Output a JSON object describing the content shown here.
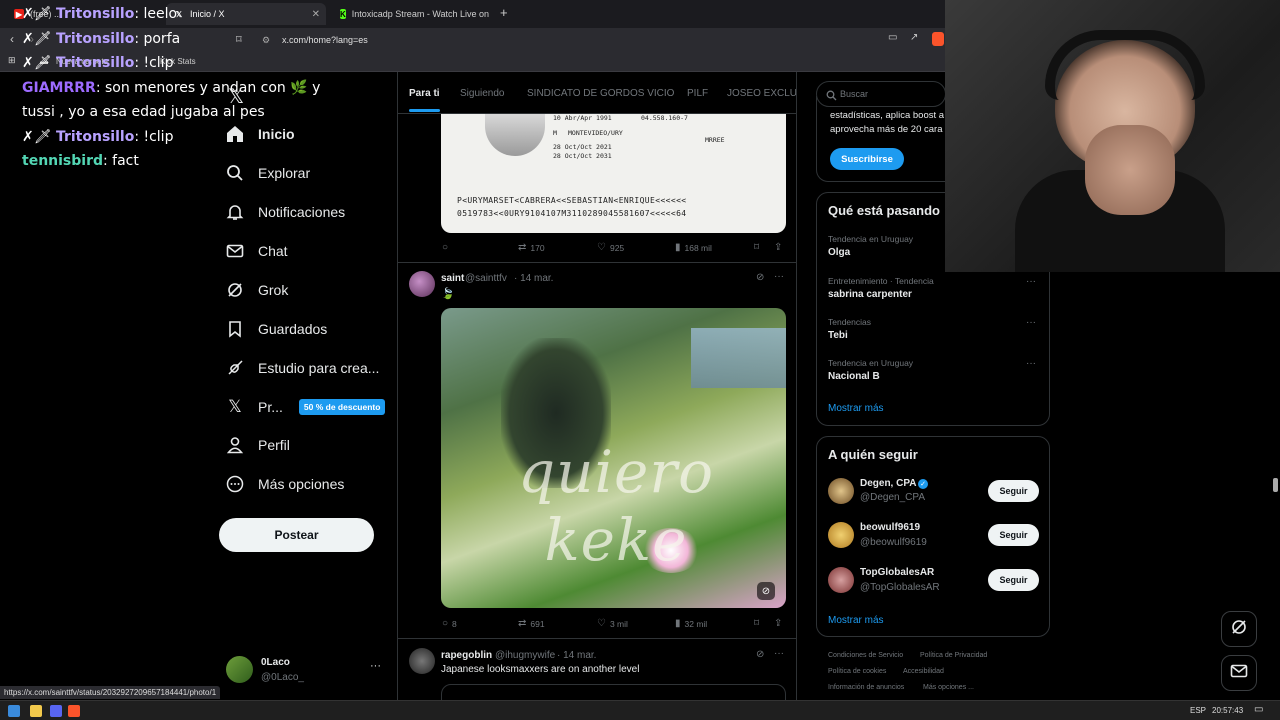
{
  "browser": {
    "tabs": [
      {
        "label": "(free) ...",
        "favicon": "youtube-icon"
      },
      {
        "label": "Inicio / X",
        "favicon": "x-logo-icon"
      },
      {
        "label": "Intoxicadp Stream - Watch Live on Ki",
        "favicon": "kick-icon"
      }
    ],
    "url": "x.com/home?lang=es",
    "bookmarks": [
      "Nueva carpeta",
      "Kick Stats"
    ],
    "status_url": "https://x.com/sainttfv/status/2032927209657184441/photo/1"
  },
  "chat": [
    {
      "user": "Tritonsillo",
      "message": "leelo",
      "badge": "sword-icon",
      "color": "#b8a2ff"
    },
    {
      "user": "Tritonsillo",
      "message": "porfa",
      "badge": "sword-icon",
      "color": "#b8a2ff"
    },
    {
      "user": "Tritonsillo",
      "message": "!clip",
      "badge": "sword-icon",
      "color": "#b8a2ff"
    },
    {
      "user": "GIAMRRR",
      "message": "son menores y andan con 🌿 y tussi , yo a esa edad jugaba al pes",
      "color": "#9d6bff"
    },
    {
      "user": "Tritonsillo",
      "message": "!clip",
      "badge": "sword-icon",
      "color": "#b8a2ff"
    },
    {
      "user": "tennisbird",
      "message": "fact",
      "color": "#53d6b4"
    }
  ],
  "nav": {
    "items": [
      {
        "label": "Inicio",
        "icon": "home-icon"
      },
      {
        "label": "Explorar",
        "icon": "search-icon"
      },
      {
        "label": "Notificaciones",
        "icon": "bell-icon"
      },
      {
        "label": "Chat",
        "icon": "mail-icon"
      },
      {
        "label": "Grok",
        "icon": "grok-icon"
      },
      {
        "label": "Guardados",
        "icon": "bookmark-icon"
      },
      {
        "label": "Estudio para crea...",
        "icon": "rocket-icon"
      },
      {
        "label": "Pr...",
        "icon": "x-logo-icon",
        "badge": "50 % de descuento"
      },
      {
        "label": "Perfil",
        "icon": "person-icon"
      },
      {
        "label": "Más opciones",
        "icon": "more-circle-icon"
      }
    ],
    "post_button": "Postear",
    "account": {
      "name": "0Laco",
      "handle": "@0Laco_"
    }
  },
  "feed": {
    "tabs": [
      "Para ti",
      "Siguiendo",
      "SINDICATO DE GORDOS VICIO",
      "PILF",
      "JOSEO EXCLUSI"
    ],
    "id_card": {
      "line1": "10 Abr/Apr 1991",
      "line2": "MONTEVIDEO/URY",
      "line3": "28 Oct/Oct 2021",
      "line4": "28 Oct/Oct 2031",
      "sex": "M",
      "num": "04.558.160-7",
      "mrz1": "P<URYMARSET<CABRERA<<SEBASTIAN<ENRIQUE<<<<<<",
      "mrz2": "0519783<<0URY9104107M3110289045581607<<<<<64",
      "country": "MRREE"
    },
    "tweet1_stats": {
      "retweets": "170",
      "likes": "925",
      "views": "168 mil"
    },
    "tweet2": {
      "name": "saint",
      "handle": "@sainttfv",
      "date": "· 14 mar.",
      "emoji": "🍃",
      "image_text": "quiero keke",
      "stats": {
        "replies": "8",
        "retweets": "691",
        "likes": "3 mil",
        "views": "32 mil"
      }
    },
    "tweet3": {
      "name": "rapegoblin",
      "handle": "@ihugmywife",
      "date": "· 14 mar.",
      "text": "Japanese looksmaxxers are on another level"
    }
  },
  "sidebar": {
    "search_placeholder": "Buscar",
    "premium_text1": "estadísticas, aplica boost a",
    "premium_text2": "aprovecha más de 20 cara",
    "subscribe": "Suscribirse",
    "trends_title": "Qué está pasando",
    "trends": [
      {
        "meta": "Tendencia en Uruguay",
        "name": "Olga"
      },
      {
        "meta": "Entretenimiento · Tendencia",
        "name": "sabrina carpenter"
      },
      {
        "meta": "Tendencias",
        "name": "Tebi"
      },
      {
        "meta": "Tendencia en Uruguay",
        "name": "Nacional B"
      }
    ],
    "show_more": "Mostrar más",
    "who_title": "A quién seguir",
    "who": [
      {
        "name": "Degen, CPA",
        "handle": "@Degen_CPA",
        "verified": true
      },
      {
        "name": "beowulf9619",
        "handle": "@beowulf9619"
      },
      {
        "name": "TopGlobalesAR",
        "handle": "@TopGlobalesAR"
      }
    ],
    "follow": "Seguir",
    "footer": [
      "Condiciones de Servicio",
      "Política de Privacidad",
      "Política de cookies",
      "Accesibilidad",
      "Información de anuncios",
      "Más opciones ..."
    ]
  },
  "taskbar": {
    "lang": "ESP",
    "time": "20:57:43"
  },
  "colors": {
    "accent": "#1d9bf0",
    "background": "#000000",
    "border": "#2f3336"
  }
}
